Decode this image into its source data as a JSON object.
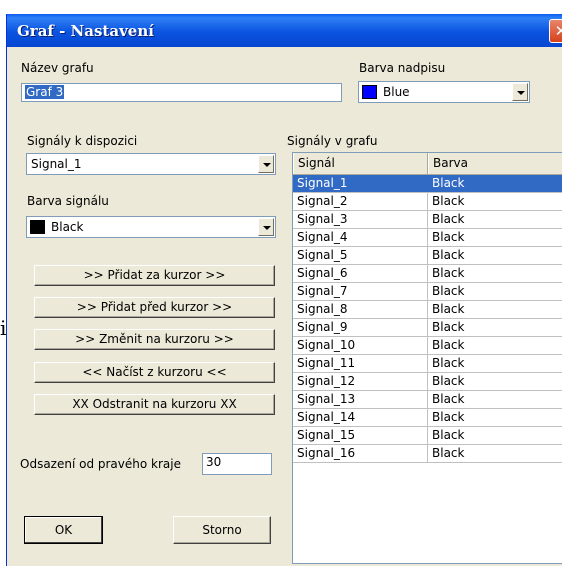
{
  "left_char": "i",
  "window": {
    "title": "Graf - Nastavení",
    "close_glyph": "✕"
  },
  "graph_name": {
    "label": "Název grafu",
    "value": "Graf 3"
  },
  "title_color": {
    "label": "Barva nadpisu",
    "value": "Blue",
    "swatch": "#0000ff"
  },
  "available_signals": {
    "label": "Signály k dispozici",
    "value": "Signal_1"
  },
  "signal_color": {
    "label": "Barva signálu",
    "value": "Black",
    "swatch": "#000000"
  },
  "buttons": {
    "add_after": ">> Přidat za kurzor >>",
    "add_before": ">> Přidat před kurzor >>",
    "change": ">> Změnit na kurzoru >>",
    "load": "<< Načíst z kurzoru <<",
    "remove": "XX Odstranit na kurzoru XX",
    "ok": "OK",
    "cancel": "Storno"
  },
  "offset": {
    "label": "Odsazení od pravého kraje",
    "value": "30"
  },
  "graph_signals": {
    "label": "Signály v grafu",
    "columns": [
      "Signál",
      "Barva"
    ],
    "selected_index": 0,
    "rows": [
      [
        "Signal_1",
        "Black"
      ],
      [
        "Signal_2",
        "Black"
      ],
      [
        "Signal_3",
        "Black"
      ],
      [
        "Signal_4",
        "Black"
      ],
      [
        "Signal_5",
        "Black"
      ],
      [
        "Signal_6",
        "Black"
      ],
      [
        "Signal_7",
        "Black"
      ],
      [
        "Signal_8",
        "Black"
      ],
      [
        "Signal_9",
        "Black"
      ],
      [
        "Signal_10",
        "Black"
      ],
      [
        "Signal_11",
        "Black"
      ],
      [
        "Signal_12",
        "Black"
      ],
      [
        "Signal_13",
        "Black"
      ],
      [
        "Signal_14",
        "Black"
      ],
      [
        "Signal_15",
        "Black"
      ],
      [
        "Signal_16",
        "Black"
      ]
    ]
  }
}
